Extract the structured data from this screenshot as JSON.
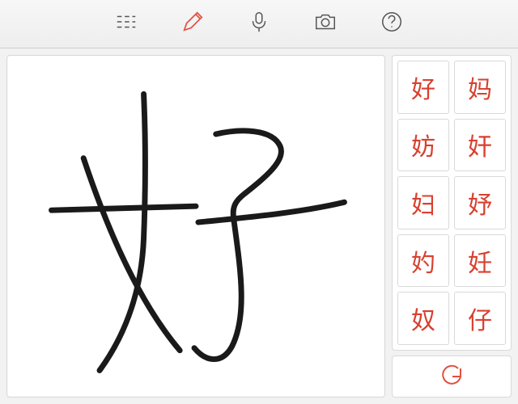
{
  "toolbar": {
    "keyboard": "keyboard-input",
    "pencil": "handwriting-input",
    "mic": "voice-input",
    "camera": "camera-input",
    "help": "help"
  },
  "handwriting": {
    "drawn_character": "好"
  },
  "candidates": {
    "items": [
      {
        "char": "好"
      },
      {
        "char": "妈"
      },
      {
        "char": "妨"
      },
      {
        "char": "奸"
      },
      {
        "char": "妇"
      },
      {
        "char": "妤"
      },
      {
        "char": "妁"
      },
      {
        "char": "妊"
      },
      {
        "char": "奴"
      },
      {
        "char": "仔"
      }
    ]
  },
  "actions": {
    "undo": "undo-stroke"
  }
}
